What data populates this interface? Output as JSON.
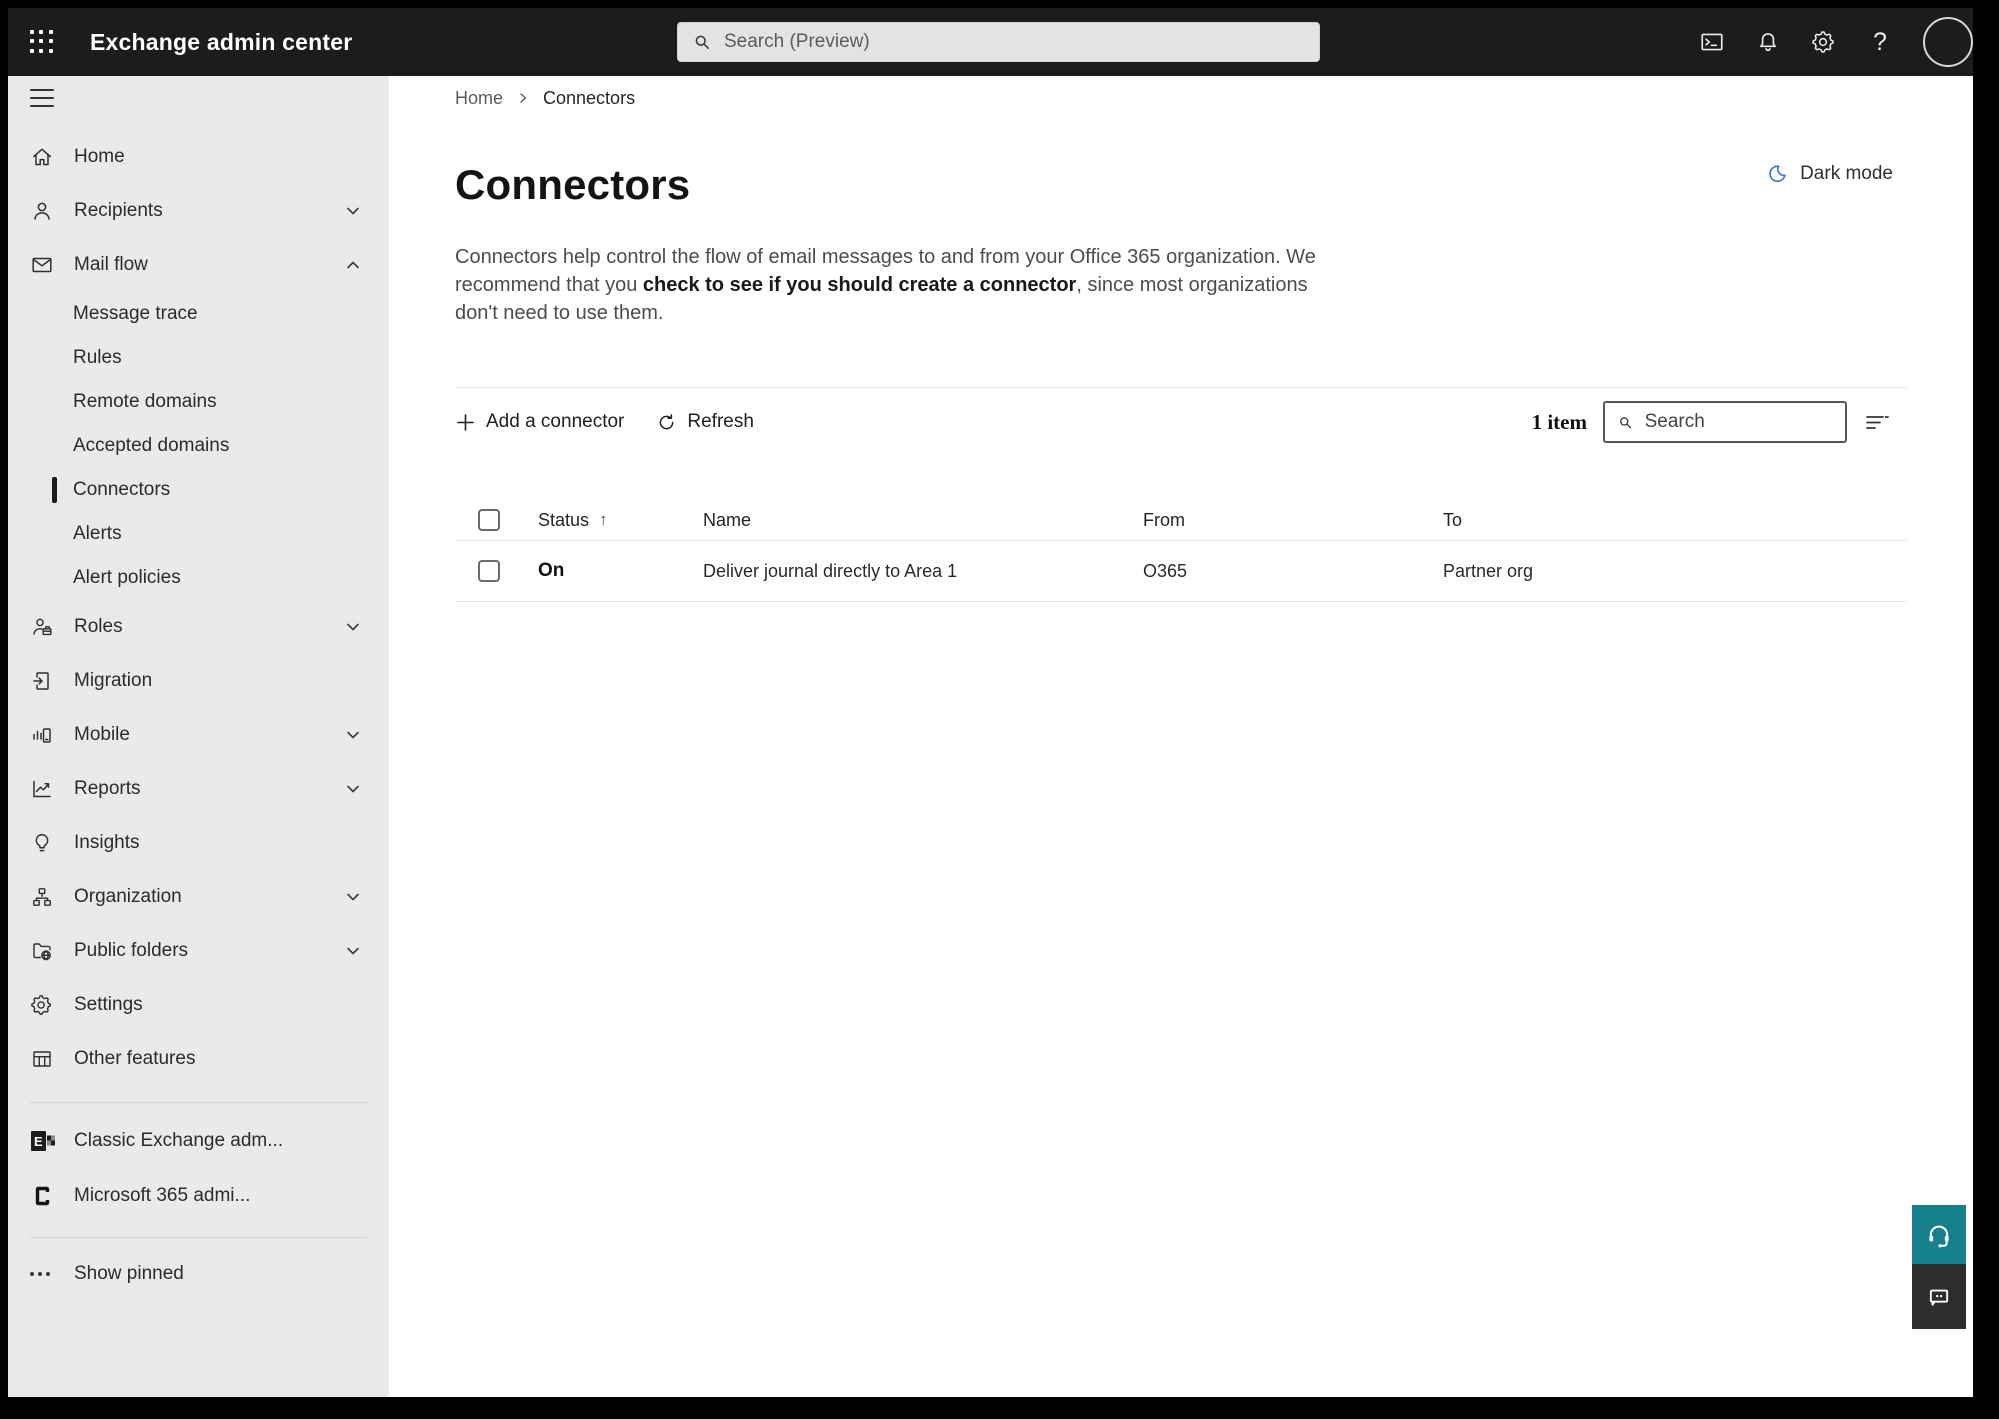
{
  "topbar": {
    "title": "Exchange admin center",
    "search_placeholder": "Search (Preview)",
    "help_glyph": "?"
  },
  "sidebar": {
    "items": [
      {
        "label": "Home",
        "icon": "home"
      },
      {
        "label": "Recipients",
        "icon": "person",
        "chevron": "down"
      },
      {
        "label": "Mail flow",
        "icon": "mail",
        "chevron": "up",
        "expanded": true
      },
      {
        "label": "Message trace",
        "sub": true
      },
      {
        "label": "Rules",
        "sub": true
      },
      {
        "label": "Remote domains",
        "sub": true
      },
      {
        "label": "Accepted domains",
        "sub": true
      },
      {
        "label": "Connectors",
        "sub": true,
        "selected": true
      },
      {
        "label": "Alerts",
        "sub": true
      },
      {
        "label": "Alert policies",
        "sub": true
      },
      {
        "label": "Roles",
        "icon": "roles",
        "chevron": "down"
      },
      {
        "label": "Migration",
        "icon": "migration"
      },
      {
        "label": "Mobile",
        "icon": "mobile",
        "chevron": "down"
      },
      {
        "label": "Reports",
        "icon": "reports",
        "chevron": "down"
      },
      {
        "label": "Insights",
        "icon": "insights"
      },
      {
        "label": "Organization",
        "icon": "organization",
        "chevron": "down"
      },
      {
        "label": "Public folders",
        "icon": "public-folders",
        "chevron": "down"
      },
      {
        "label": "Settings",
        "icon": "settings"
      },
      {
        "label": "Other features",
        "icon": "other-features"
      }
    ],
    "footer_items": [
      {
        "label": "Classic Exchange adm...",
        "icon": "exchange-logo"
      },
      {
        "label": "Microsoft 365 admi...",
        "icon": "m365-logo"
      }
    ],
    "show_pinned_label": "Show pinned"
  },
  "breadcrumb": {
    "home": "Home",
    "current": "Connectors"
  },
  "dark_mode_label": "Dark mode",
  "page": {
    "title": "Connectors",
    "description_pre": "Connectors help control the flow of email messages to and from your Office 365 organization. We recommend that you ",
    "description_emphasis": "check to see if you should create a connector",
    "description_post": ", since most organizations don't need to use them."
  },
  "toolbar": {
    "add_label": "Add a connector",
    "refresh_label": "Refresh",
    "item_count": "1 item",
    "search_placeholder": "Search"
  },
  "table": {
    "headers": {
      "status": "Status",
      "name": "Name",
      "from": "From",
      "to": "To"
    },
    "sort_icon": "↑",
    "rows": [
      {
        "status": "On",
        "name": "Deliver journal directly to Area 1",
        "from": "O365",
        "to": "Partner org"
      }
    ]
  },
  "colors": {
    "topbar_bg": "#1c1c1c",
    "sidebar_bg": "#eaeaea",
    "accent_teal": "#17808d",
    "chat_button": "#2d2d2d",
    "moon_blue": "#3b76d6"
  }
}
